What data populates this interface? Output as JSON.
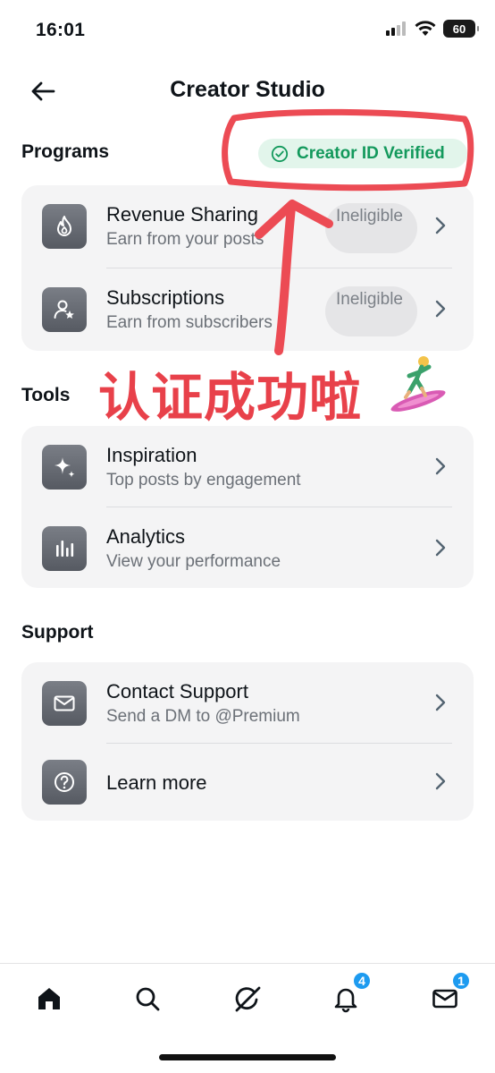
{
  "status_bar": {
    "time": "16:01",
    "battery": "60"
  },
  "header": {
    "title": "Creator Studio"
  },
  "programs": {
    "title": "Programs",
    "badge": "Creator ID Verified",
    "items": [
      {
        "title": "Revenue Sharing",
        "subtitle": "Earn from your posts",
        "status": "Ineligible",
        "icon": "flame-icon"
      },
      {
        "title": "Subscriptions",
        "subtitle": "Earn from subscribers",
        "status": "Ineligible",
        "icon": "person-star-icon"
      }
    ]
  },
  "annotation": {
    "text": "认证成功啦"
  },
  "tools": {
    "title": "Tools",
    "items": [
      {
        "title": "Inspiration",
        "subtitle": "Top posts by engagement",
        "icon": "sparkle-icon"
      },
      {
        "title": "Analytics",
        "subtitle": "View your performance",
        "icon": "bar-chart-icon"
      }
    ]
  },
  "support": {
    "title": "Support",
    "items": [
      {
        "title": "Contact Support",
        "subtitle": "Send a DM to @Premium",
        "icon": "envelope-icon"
      },
      {
        "title": "Learn more",
        "icon": "question-icon"
      }
    ]
  },
  "tabbar": {
    "items": [
      {
        "name": "home",
        "icon": "home-icon"
      },
      {
        "name": "search",
        "icon": "search-icon"
      },
      {
        "name": "grok",
        "icon": "grok-icon"
      },
      {
        "name": "notifications",
        "icon": "bell-icon",
        "badge": "4"
      },
      {
        "name": "messages",
        "icon": "envelope-icon",
        "badge": "1"
      }
    ]
  },
  "colors": {
    "accent": "#1d9bf0",
    "verified_green": "#13995c",
    "annotation_red": "#e8414a"
  }
}
